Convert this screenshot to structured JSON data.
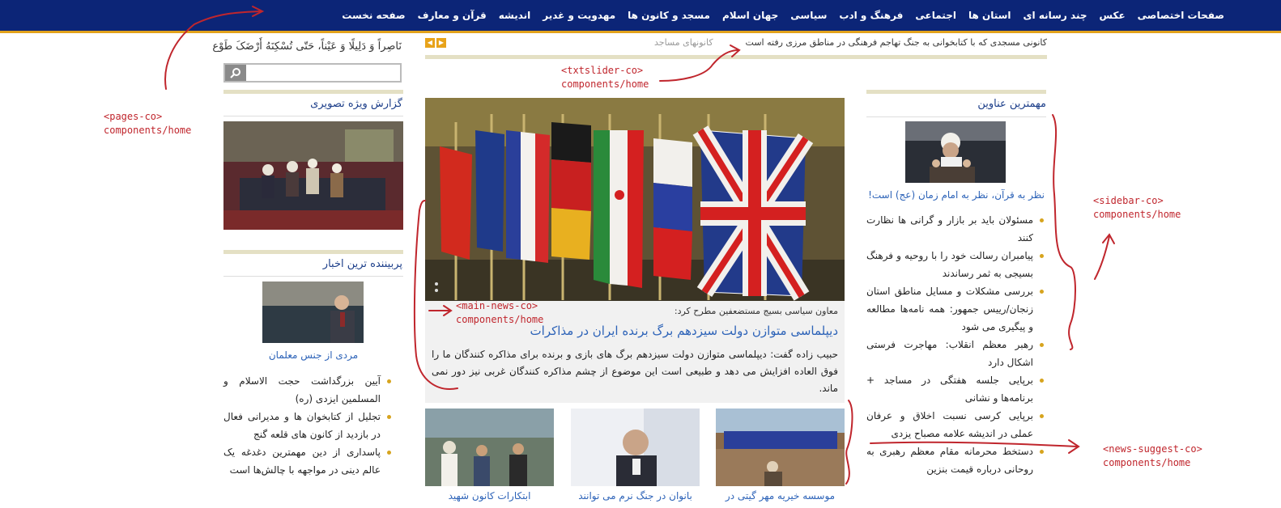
{
  "nav": {
    "items": [
      "صفحه نخست",
      "قرآن و معارف",
      "اندیشه",
      "مهدویت و غدیر",
      "مسجد و کانون ها",
      "جهان اسلام",
      "سیاسی",
      "فرهنگ و ادب",
      "اجتماعی",
      "استان ها",
      "چند رسانه ای",
      "عکس",
      "صفحات اختصاصی"
    ]
  },
  "ticker": {
    "text": "کانونی مسجدی که با کتابخوانی به جنگ تهاجم فرهنگی در مناطق مرزی رفته است",
    "category": "کانونهای مساجد",
    "prev_arrow": "◀",
    "next_arrow": "▶"
  },
  "left": {
    "prayer": "نَاصِراً وَ دَلِیلًا وَ عَیْناً، حَتّی تُسْکِنَهُ أَرْضَکَ طَوْع",
    "search": {
      "placeholder": "",
      "icon": "search-icon"
    },
    "photo_report": {
      "title": "گزارش ویژه تصویری"
    },
    "popular": {
      "title": "پربیننده ترین اخبار",
      "caption": "مردی از جنس معلمان",
      "items": [
        "آیین بزرگداشت حجت الاسلام و المسلمین ایزدی (ره)",
        "تجلیل از کتابخوان ها و مدیرانی فعال در بازدید از کانون های قلعه گنج",
        "پاسداری از دین مهمترین دغدغه یک عالم دینی در مواجهه با چالش‌ها است"
      ]
    }
  },
  "main": {
    "lead": "معاون سیاسی بسیج مستضعفین مطرح کرد:",
    "title": "دیپلماسی متوازن دولت سیزدهم برگ برنده ایران در مذاکرات",
    "body": "حبیب زاده گفت: دیپلماسی متوازن دولت سیزدهم برگ های بازی و برنده برای مذاکره کنندگان ما را فوق العاده افزایش می دهد و طبیعی است این موضوع از چشم مذاکره کنندگان غربی نیز دور نمی ماند.",
    "thumbs": [
      "موسسه خیریه مهر گیتی در",
      "بانوان در جنگ نرم می توانند",
      "ابتکارات کانون شهید"
    ]
  },
  "sidebar": {
    "title": "مهمترین عناوین",
    "caption": "نظر به قرآن، نظر به امام زمان (عج) است!",
    "items": [
      "مسئولان باید بر بازار و گرانی ها نظارت کنند",
      "پیامبران رسالت خود را با روحیه و فرهنگ بسیجی به ثمر رساندند",
      "بررسی مشکلات و مسایل مناطق استان زنجان/رییس جمهور: همه نامه‌ها مطالعه و پیگیری می شود",
      "رهبر معظم انقلاب: مهاجرت فرستی اشکال دارد",
      "برپایی جلسه هفتگی در مساجد + برنامه‌ها و نشانی",
      "برپایی کرسی نسبت اخلاق و عرفان عملی در اندیشه علامه مصباح یزدی",
      "دستخط محرمانه مقام معظم رهبری به روحانی درباره قیمت بنزین"
    ]
  },
  "annotations": {
    "pages": "<pages-co>\ncomponents/home",
    "txtslider": "<txtslider-co>\ncomponents/home",
    "main_news": "<main-news-co>\ncomponents/home",
    "sidebar": "<sidebar-co>\ncomponents/home",
    "news_suggest": "<news-suggest-co>\ncomponents/home"
  },
  "colors": {
    "nav_bg": "#0c2577",
    "nav_border": "#e2a21c",
    "link": "#2d63b8",
    "bullet": "#d7a41e",
    "annotation": "#c0262d"
  }
}
